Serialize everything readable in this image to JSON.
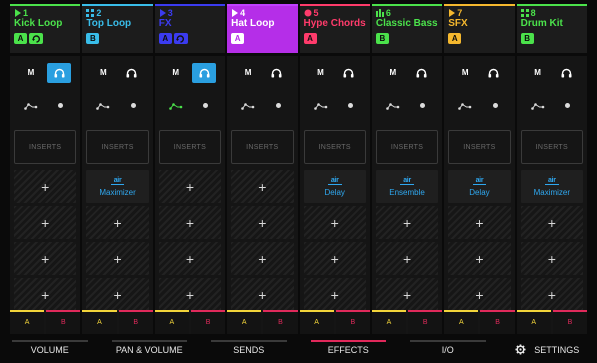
{
  "tracks": [
    {
      "number": "1",
      "name": "Kick Loop",
      "icon": "audio-play-icon",
      "color": "#4be24b",
      "badges": [
        {
          "text": "A",
          "kind": "letter"
        },
        {
          "text": "",
          "kind": "loop"
        }
      ],
      "bar": "#4be24b",
      "m": "M",
      "hp_on": true,
      "auto_color": "#dcdcdc",
      "insert": "INSERTS",
      "fx": [],
      "a": "A",
      "b": "B"
    },
    {
      "number": "2",
      "name": "Top Loop",
      "icon": "grid-icon",
      "color": "#39bde9",
      "badges": [
        {
          "text": "B",
          "kind": "letter"
        }
      ],
      "bar": "#39bde9",
      "m": "M",
      "hp_on": false,
      "auto_color": "#dcdcdc",
      "insert": "INSERTS",
      "fx": [
        "Maximizer"
      ],
      "a": "A",
      "b": "B"
    },
    {
      "number": "3",
      "name": "FX",
      "icon": "audio-play-icon",
      "color": "#3b3bf0",
      "badges": [
        {
          "text": "A",
          "kind": "letter"
        },
        {
          "text": "",
          "kind": "loop"
        }
      ],
      "bar": "#3b3bf0",
      "m": "M",
      "hp_on": true,
      "auto_color": "#4be24b",
      "insert": "INSERTS",
      "fx": [],
      "a": "A",
      "b": "B"
    },
    {
      "number": "4",
      "name": "Hat Loop",
      "icon": "audio-play-icon",
      "color": "#ffffff",
      "badges": [
        {
          "text": "A",
          "kind": "letter"
        }
      ],
      "bar": "#c040ff",
      "m": "M",
      "hp_on": false,
      "auto_color": "#dcdcdc",
      "insert": "INSERTS",
      "fx": [],
      "a": "A",
      "b": "B"
    },
    {
      "number": "5",
      "name": "Hype Chords",
      "icon": "keys-icon",
      "color": "#ff3b6b",
      "badges": [
        {
          "text": "A",
          "kind": "letter"
        }
      ],
      "bar": "#ff3b6b",
      "m": "M",
      "hp_on": false,
      "auto_color": "#dcdcdc",
      "insert": "INSERTS",
      "fx": [
        "Delay"
      ],
      "a": "A",
      "b": "B"
    },
    {
      "number": "6",
      "name": "Classic Bass",
      "icon": "bars-icon",
      "color": "#4be24b",
      "badges": [
        {
          "text": "B",
          "kind": "letter"
        }
      ],
      "bar": "#4be24b",
      "m": "M",
      "hp_on": false,
      "auto_color": "#dcdcdc",
      "insert": "INSERTS",
      "fx": [
        "Ensemble"
      ],
      "a": "A",
      "b": "B"
    },
    {
      "number": "7",
      "name": "SFX",
      "icon": "audio-play-icon",
      "color": "#f5b82e",
      "badges": [
        {
          "text": "A",
          "kind": "letter"
        }
      ],
      "bar": "#f5b82e",
      "m": "M",
      "hp_on": false,
      "auto_color": "#dcdcdc",
      "insert": "INSERTS",
      "fx": [
        "Delay"
      ],
      "a": "A",
      "b": "B"
    },
    {
      "number": "8",
      "name": "Drum Kit",
      "icon": "grid-icon",
      "color": "#4be24b",
      "badges": [
        {
          "text": "B",
          "kind": "letter"
        }
      ],
      "bar": "#4be24b",
      "m": "M",
      "hp_on": false,
      "auto_color": "#dcdcdc",
      "insert": "INSERTS",
      "fx": [
        "Maximizer"
      ],
      "a": "A",
      "b": "B"
    }
  ],
  "fx_logo": "air",
  "empty_slot": "+",
  "tabs": [
    {
      "label": "VOLUME",
      "active": false
    },
    {
      "label": "PAN & VOLUME",
      "active": false
    },
    {
      "label": "SENDS",
      "active": false
    },
    {
      "label": "EFFECTS",
      "active": true
    },
    {
      "label": "I/O",
      "active": false
    },
    {
      "label": "SETTINGS",
      "active": false,
      "icon": "gear-icon"
    }
  ],
  "colors": {
    "a_accent": "#f2d43a",
    "b_accent": "#e02a5b",
    "active_tab": "#e0285a",
    "headphones_on": "#2a9fe0"
  }
}
